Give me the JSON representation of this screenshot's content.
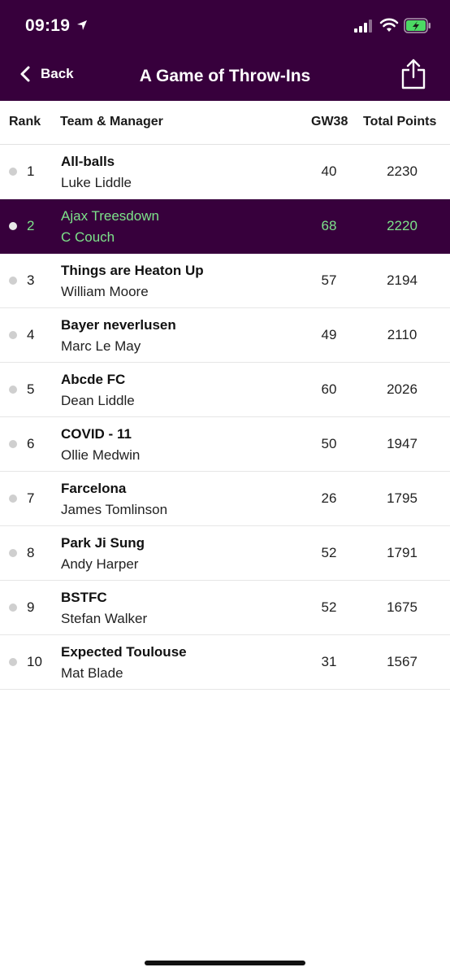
{
  "status_bar": {
    "time": "09:19"
  },
  "nav": {
    "back_label": "Back",
    "title": "A Game of Throw-Ins"
  },
  "columns": {
    "rank": "Rank",
    "team": "Team & Manager",
    "gw": "GW38",
    "total": "Total Points"
  },
  "rows": [
    {
      "rank": "1",
      "team": "All-balls",
      "manager": "Luke Liddle",
      "gw": "40",
      "total": "2230"
    },
    {
      "rank": "2",
      "team": "Ajax Treesdown",
      "manager": "C Couch",
      "gw": "68",
      "total": "2220"
    },
    {
      "rank": "3",
      "team": "Things are Heaton Up",
      "manager": "William Moore",
      "gw": "57",
      "total": "2194"
    },
    {
      "rank": "4",
      "team": "Bayer neverlusen",
      "manager": "Marc Le May",
      "gw": "49",
      "total": "2110"
    },
    {
      "rank": "5",
      "team": "Abcde FC",
      "manager": "Dean Liddle",
      "gw": "60",
      "total": "2026"
    },
    {
      "rank": "6",
      "team": "COVID - 11",
      "manager": "Ollie Medwin",
      "gw": "50",
      "total": "1947"
    },
    {
      "rank": "7",
      "team": "Farcelona",
      "manager": "James Tomlinson",
      "gw": "26",
      "total": "1795"
    },
    {
      "rank": "8",
      "team": "Park Ji Sung",
      "manager": "Andy Harper",
      "gw": "52",
      "total": "1791"
    },
    {
      "rank": "9",
      "team": "BSTFC",
      "manager": "Stefan Walker",
      "gw": "52",
      "total": "1675"
    },
    {
      "rank": "10",
      "team": "Expected Toulouse",
      "manager": "Mat Blade",
      "gw": "31",
      "total": "1567"
    }
  ],
  "colors": {
    "header_bg": "#37003c",
    "highlight_text": "#7de38a"
  }
}
